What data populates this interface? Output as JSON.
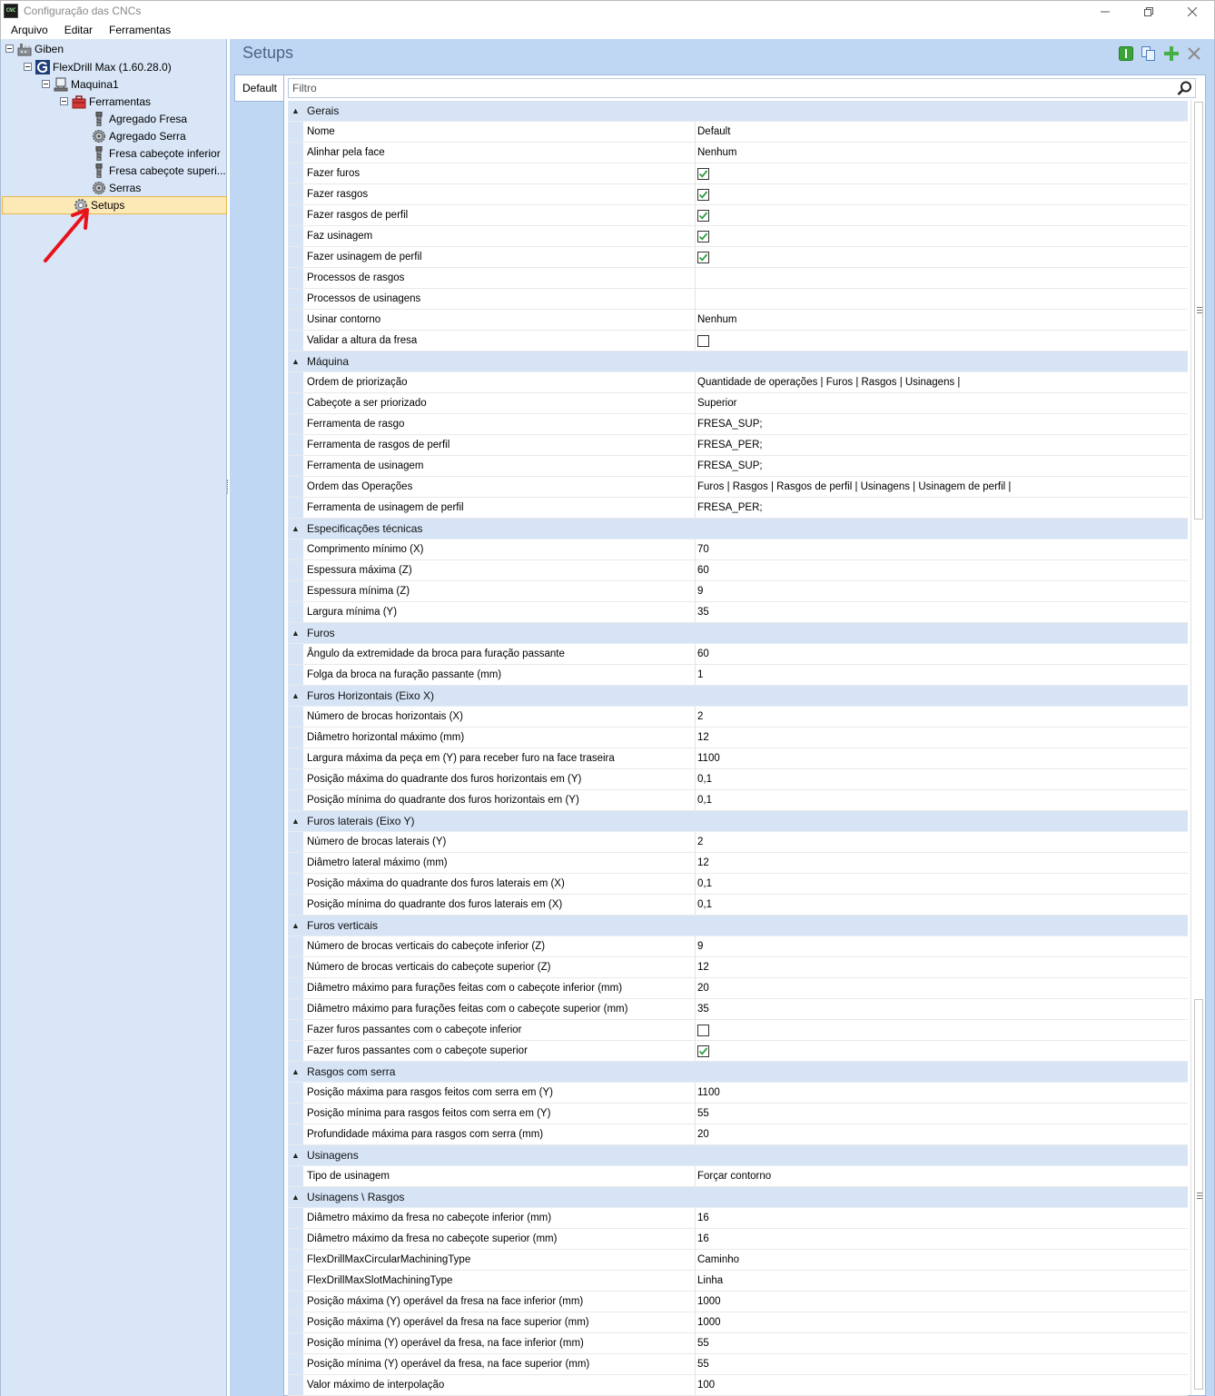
{
  "window": {
    "title": "Configuração das CNCs",
    "icon_text": "CNC"
  },
  "menu": [
    "Arquivo",
    "Editar",
    "Ferramentas"
  ],
  "tree": [
    {
      "label": "Giben",
      "icon": "factory-icon",
      "level": 0,
      "toggle": true
    },
    {
      "label": "FlexDrill Max (1.60.28.0)",
      "icon": "g-logo-icon",
      "level": 1,
      "toggle": true
    },
    {
      "label": "Maquina1",
      "icon": "machine-icon",
      "level": 2,
      "toggle": true
    },
    {
      "label": "Ferramentas",
      "icon": "toolbox-icon",
      "level": 3,
      "toggle": true
    },
    {
      "label": "Agregado Fresa",
      "icon": "mill-tool-icon",
      "level": 4,
      "toggle": false
    },
    {
      "label": "Agregado Serra",
      "icon": "saw-gear-icon",
      "level": 4,
      "toggle": false
    },
    {
      "label": "Fresa cabeçote inferior",
      "icon": "mill-tool-icon",
      "level": 4,
      "toggle": false
    },
    {
      "label": "Fresa  cabeçote  superi...",
      "icon": "mill-tool-icon",
      "level": 4,
      "toggle": false
    },
    {
      "label": "Serras",
      "icon": "saw-gear-icon",
      "level": 4,
      "toggle": false
    },
    {
      "label": "Setups",
      "icon": "settings-gear-icon",
      "level": 3,
      "toggle": false,
      "selected": true
    }
  ],
  "panel": {
    "title": "Setups",
    "tab": "Default",
    "filter_placeholder": "Filtro"
  },
  "toolbar_icons": [
    "info-icon",
    "copy-icon",
    "add-icon",
    "close-icon"
  ],
  "categories": [
    {
      "name": "Gerais",
      "props": [
        {
          "name": "Nome",
          "value": "Default"
        },
        {
          "name": "Alinhar pela face",
          "value": "Nenhum"
        },
        {
          "name": "Fazer furos",
          "check": true
        },
        {
          "name": "Fazer rasgos",
          "check": true
        },
        {
          "name": "Fazer rasgos de perfil",
          "check": true
        },
        {
          "name": "Faz usinagem",
          "check": true
        },
        {
          "name": "Fazer usinagem de perfil",
          "check": true
        },
        {
          "name": "Processos de rasgos",
          "value": ""
        },
        {
          "name": "Processos de usinagens",
          "value": ""
        },
        {
          "name": "Usinar contorno",
          "value": "Nenhum"
        },
        {
          "name": "Validar a altura da fresa",
          "check": false
        }
      ]
    },
    {
      "name": "Máquina",
      "props": [
        {
          "name": "Ordem de priorização",
          "value": "Quantidade de operações | Furos | Rasgos | Usinagens |"
        },
        {
          "name": "Cabeçote a ser priorizado",
          "value": "Superior"
        },
        {
          "name": "Ferramenta de rasgo",
          "value": "FRESA_SUP;"
        },
        {
          "name": "Ferramenta de rasgos de perfil",
          "value": "FRESA_PER;"
        },
        {
          "name": "Ferramenta de usinagem",
          "value": "FRESA_SUP;"
        },
        {
          "name": "Ordem das Operações",
          "value": "Furos | Rasgos | Rasgos de perfil | Usinagens | Usinagem de perfil |"
        },
        {
          "name": "Ferramenta de usinagem de perfil",
          "value": "FRESA_PER;"
        }
      ]
    },
    {
      "name": "Especificações técnicas",
      "props": [
        {
          "name": "Comprimento mínimo (X)",
          "value": "70"
        },
        {
          "name": "Espessura máxima (Z)",
          "value": "60"
        },
        {
          "name": "Espessura mínima (Z)",
          "value": "9"
        },
        {
          "name": "Largura mínima (Y)",
          "value": "35"
        }
      ]
    },
    {
      "name": "Furos",
      "props": [
        {
          "name": "Ângulo da extremidade da broca para furação passante",
          "value": "60"
        },
        {
          "name": "Folga da broca na furação passante (mm)",
          "value": "1"
        }
      ]
    },
    {
      "name": "Furos Horizontais (Eixo X)",
      "props": [
        {
          "name": "Número de brocas horizontais (X)",
          "value": "2"
        },
        {
          "name": "Diâmetro horizontal máximo (mm)",
          "value": "12"
        },
        {
          "name": "Largura máxima da peça em (Y) para receber furo na face traseira",
          "value": "1100"
        },
        {
          "name": "Posição máxima do quadrante dos furos horizontais em (Y)",
          "value": "0,1"
        },
        {
          "name": "Posição mínima do quadrante dos furos horizontais em (Y)",
          "value": "0,1"
        }
      ]
    },
    {
      "name": "Furos laterais (Eixo Y)",
      "props": [
        {
          "name": "Número de brocas laterais (Y)",
          "value": "2"
        },
        {
          "name": "Diâmetro lateral máximo (mm)",
          "value": "12"
        },
        {
          "name": "Posição máxima do quadrante dos furos laterais em (X)",
          "value": "0,1"
        },
        {
          "name": "Posição mínima do quadrante dos furos laterais em (X)",
          "value": "0,1"
        }
      ]
    },
    {
      "name": "Furos verticais",
      "props": [
        {
          "name": "Número de brocas verticais do cabeçote inferior (Z)",
          "value": "9"
        },
        {
          "name": "Número de brocas verticais do cabeçote superior (Z)",
          "value": "12"
        },
        {
          "name": "Diâmetro máximo para furações feitas com o cabeçote inferior (mm)",
          "value": "20"
        },
        {
          "name": "Diâmetro máximo para furações feitas com o cabeçote superior (mm)",
          "value": "35"
        },
        {
          "name": "Fazer furos passantes com o cabeçote inferior",
          "check": false
        },
        {
          "name": "Fazer furos passantes com o cabeçote superior",
          "check": true
        }
      ]
    },
    {
      "name": "Rasgos com serra",
      "props": [
        {
          "name": "Posição máxima para rasgos feitos com serra em (Y)",
          "value": "1100"
        },
        {
          "name": "Posição mínima para rasgos feitos com serra em (Y)",
          "value": "55"
        },
        {
          "name": "Profundidade máxima para rasgos com serra (mm)",
          "value": "20"
        }
      ]
    },
    {
      "name": "Usinagens",
      "props": [
        {
          "name": "Tipo de usinagem",
          "value": "Forçar contorno"
        }
      ]
    },
    {
      "name": "Usinagens \\ Rasgos",
      "props": [
        {
          "name": "Diâmetro máximo da fresa no cabeçote inferior (mm)",
          "value": "16"
        },
        {
          "name": "Diâmetro máximo da fresa no cabeçote superior (mm)",
          "value": "16"
        },
        {
          "name": "FlexDrillMaxCircularMachiningType",
          "value": "Caminho"
        },
        {
          "name": "FlexDrillMaxSlotMachiningType",
          "value": "Linha"
        },
        {
          "name": "Posição máxima (Y) operável da fresa na face inferior (mm)",
          "value": "1000"
        },
        {
          "name": "Posição máxima (Y) operável da fresa na face superior (mm)",
          "value": "1000"
        },
        {
          "name": "Posição mínima (Y) operável da fresa, na face inferior (mm)",
          "value": "55"
        },
        {
          "name": "Posição mínima (Y) operável da fresa, na face superior (mm)",
          "value": "55"
        },
        {
          "name": "Valor máximo de interpolação",
          "value": "100"
        }
      ]
    }
  ],
  "colors": {
    "accent_blue": "#bfd7f3",
    "category_bg": "#d6e4f5",
    "selection": "#fde9b5",
    "check_green": "#2e9e3e",
    "arrow_red": "#e8121b"
  }
}
